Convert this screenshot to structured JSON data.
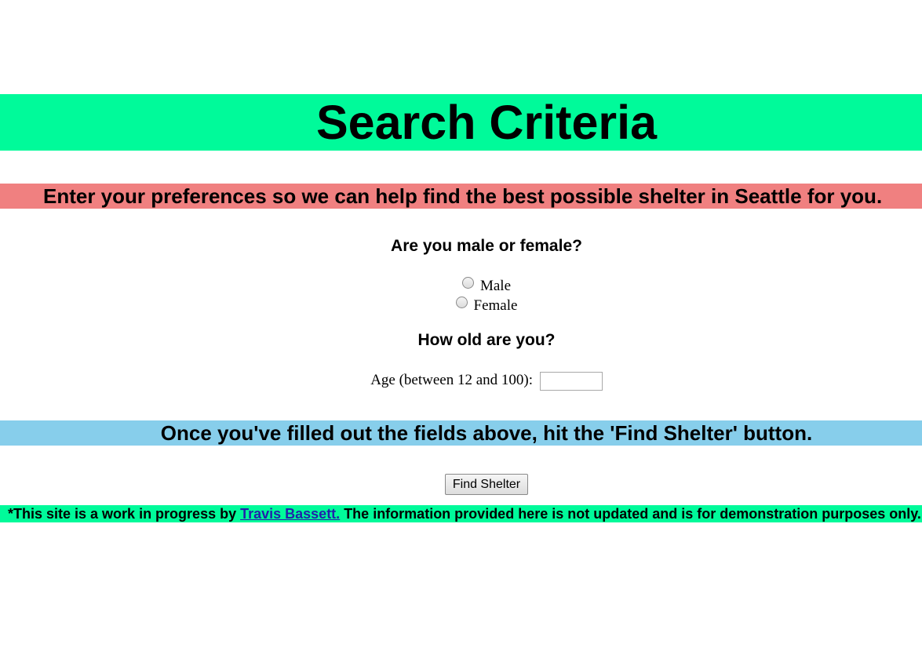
{
  "header": {
    "title": "Search Criteria"
  },
  "intro": {
    "text": "Enter your preferences so we can help find the best possible shelter in Seattle for you."
  },
  "gender": {
    "question": "Are you male or female?",
    "options": [
      "Male",
      "Female"
    ]
  },
  "age": {
    "question": "How old are you?",
    "label": "Age (between 12 and 100):",
    "value": ""
  },
  "hint": {
    "text": "Once you've filled out the fields above, hit the 'Find Shelter' button."
  },
  "actions": {
    "find_label": "Find Shelter"
  },
  "footer": {
    "prefix": "*This site is a work in progress by ",
    "author_link": "Travis Bassett.",
    "suffix": " The information provided here is not updated and is for demonstration purposes only."
  },
  "colors": {
    "title_banner": "#00fa9a",
    "intro_banner": "#f08080",
    "hint_banner": "#87ceeb",
    "footer_banner": "#00fa9a"
  }
}
